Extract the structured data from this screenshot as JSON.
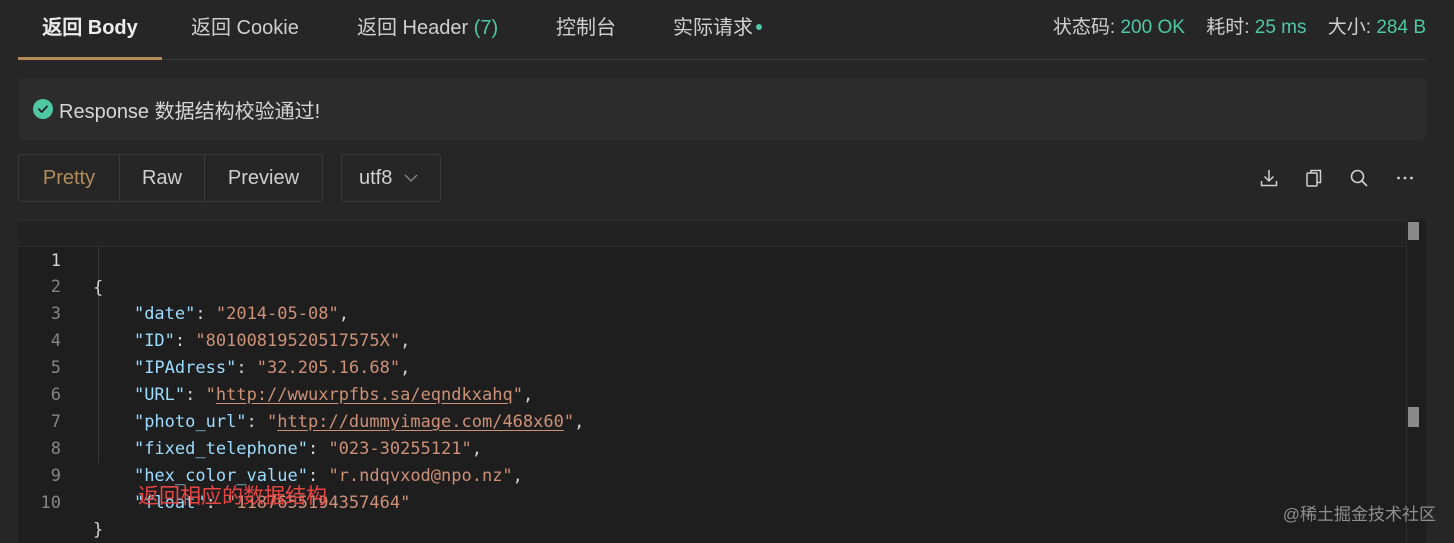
{
  "tabs": [
    {
      "label": "返回 Body",
      "active": true
    },
    {
      "label": "返回 Cookie"
    },
    {
      "label": "返回 Header",
      "count": "(7)"
    },
    {
      "label": "控制台"
    },
    {
      "label": "实际请求"
    }
  ],
  "status": {
    "code_label": "状态码:",
    "code_value": "200 OK",
    "time_label": "耗时:",
    "time_value": "25 ms",
    "size_label": "大小:",
    "size_value": "284 B"
  },
  "banner": {
    "text": "Response 数据结构校验通过!"
  },
  "toolbar": {
    "views": [
      "Pretty",
      "Raw",
      "Preview"
    ],
    "active_view": "Pretty",
    "encoding": "utf8",
    "icons": [
      "download-icon",
      "copy-icon",
      "search-icon",
      "more-icon"
    ]
  },
  "editor": {
    "line_numbers": [
      "1",
      "2",
      "3",
      "4",
      "5",
      "6",
      "7",
      "8",
      "9",
      "10"
    ],
    "open_brace": "{",
    "close_brace": "}",
    "entries": [
      {
        "key": "\"date\"",
        "value": "\"2014-05-08\""
      },
      {
        "key": "\"ID\"",
        "value": "\"80100819520517575X\""
      },
      {
        "key": "\"IPAdress\"",
        "value": "\"32.205.16.68\""
      },
      {
        "key": "\"URL\"",
        "value": "http://wwuxrpfbs.sa/eqndkxahq"
      },
      {
        "key": "\"photo_url\"",
        "value": "http://dummyimage.com/468x60"
      },
      {
        "key": "\"fixed_telephone\"",
        "value": "\"023-30255121\""
      },
      {
        "key": "\"hex_color_value\"",
        "value": "\"r.ndqvxod@npo.nz\""
      },
      {
        "key": "\"float\"",
        "value": "\"1187655194357464\""
      }
    ],
    "annotation": "返回相应的数据结构"
  },
  "watermark": "@稀土掘金技术社区",
  "colors": {
    "accent": "#b58c57",
    "success": "#4ec9a4",
    "json_key": "#9cdcfe",
    "json_string": "#ce9178",
    "annotation": "#e84545"
  }
}
